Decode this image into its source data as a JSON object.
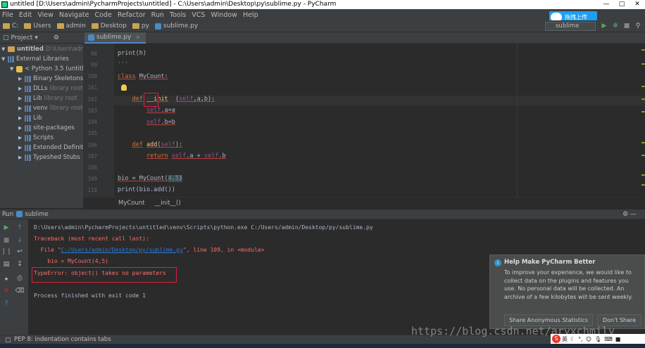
{
  "window": {
    "title": "untitled [D:\\Users\\admin\\PycharmProjects\\untitled] - C:\\Users\\admin\\Desktop\\py\\sublime.py - PyCharm"
  },
  "menu": [
    "File",
    "Edit",
    "View",
    "Navigate",
    "Code",
    "Refactor",
    "Run",
    "Tools",
    "VCS",
    "Window",
    "Help"
  ],
  "upload_badge": "拖拽上传",
  "navbar": {
    "crumbs": [
      "C:",
      "Users",
      "admin",
      "Desktop",
      "py",
      "sublime.py"
    ],
    "run_config": "sublime"
  },
  "project": {
    "header": "Project",
    "tree": [
      {
        "label": "untitled",
        "path": "D:\\Users\\adm",
        "depth": 0,
        "open": true
      },
      {
        "label": "External Libraries",
        "path": "",
        "depth": 0,
        "open": true
      },
      {
        "label": "< Python 3.5 (untitle",
        "path": "",
        "depth": 1,
        "open": true
      },
      {
        "label": "Binary Skeletons",
        "path": "",
        "depth": 2
      },
      {
        "label": "DLLs",
        "path": "library root",
        "depth": 2
      },
      {
        "label": "Lib",
        "path": "library root",
        "depth": 2
      },
      {
        "label": "venv",
        "path": "library root",
        "depth": 2
      },
      {
        "label": "Lib",
        "path": "",
        "depth": 2
      },
      {
        "label": "site-packages",
        "path": "",
        "depth": 2
      },
      {
        "label": "Scripts",
        "path": "",
        "depth": 2
      },
      {
        "label": "Extended Definiti",
        "path": "",
        "depth": 2
      },
      {
        "label": "Typeshed Stubs",
        "path": "",
        "depth": 1
      }
    ]
  },
  "editor": {
    "tab": "sublime.py",
    "line_numbers": [
      "98",
      "99",
      "100",
      "101",
      "102",
      "103",
      "104",
      "105",
      "106",
      "107",
      "108",
      "109",
      "110"
    ],
    "breadcrumb": [
      "MyCount",
      "__init__()"
    ]
  },
  "run": {
    "header": "Run",
    "config": "sublime",
    "lines": [
      {
        "text": "D:\\Users\\admin\\PycharmProjects\\untitled\\venv\\Scripts\\python.exe C:/Users/admin/Desktop/py/sublime.py",
        "kind": "normal"
      },
      {
        "text": "Traceback (most recent call last):",
        "kind": "err"
      },
      {
        "text_pre": "  File \"",
        "link": "C:/Users/admin/Desktop/py/sublime.py",
        "text_post": "\", line 109, in <module>",
        "kind": "err"
      },
      {
        "text": "    bio = MyCount(4,5)",
        "kind": "err"
      },
      {
        "text": "TypeError: object() takes no parameters",
        "kind": "err"
      },
      {
        "text": "Process finished with exit code 1",
        "kind": "normal"
      }
    ]
  },
  "notification": {
    "title": "Help Make PyCharm Better",
    "body": "To improve your experience, we would like to collect data on the plugins and features you use. No personal data will be collected. An archive of a few kilobytes will be sent weekly.",
    "btn_share": "Share Anonymous Statistics",
    "btn_dont": "Don't Share"
  },
  "statusbar": {
    "message": "PEP 8: indentation contains tabs"
  },
  "watermark": "https://blog.csdn.net/aryxchmily",
  "ime": "英"
}
